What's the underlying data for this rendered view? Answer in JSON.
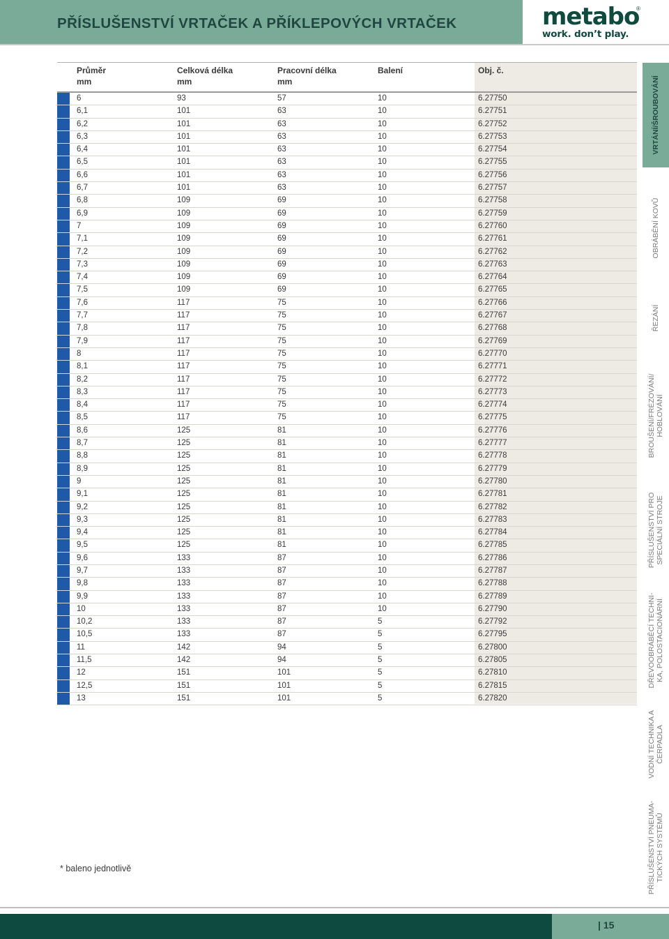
{
  "header": {
    "title": "PŘÍSLUŠENSTVÍ VRTAČEK A PŘÍKLEPOVÝCH VRTAČEK"
  },
  "brand": {
    "logo_text": "metabo",
    "registered": "®",
    "tagline": "work. don’t play.",
    "color": "#0f4a3e",
    "accent": "#7aab99",
    "row_marker_color": "#1f5aa8"
  },
  "table": {
    "columns": [
      {
        "label": "Průměr",
        "unit": "mm"
      },
      {
        "label": "Celková délka",
        "unit": "mm"
      },
      {
        "label": "Pracovní délka",
        "unit": "mm"
      },
      {
        "label": "Balení",
        "unit": ""
      },
      {
        "label": "Obj. č.",
        "unit": ""
      }
    ],
    "rows": [
      [
        "6",
        "93",
        "57",
        "10",
        "6.27750"
      ],
      [
        "6,1",
        "101",
        "63",
        "10",
        "6.27751"
      ],
      [
        "6,2",
        "101",
        "63",
        "10",
        "6.27752"
      ],
      [
        "6,3",
        "101",
        "63",
        "10",
        "6.27753"
      ],
      [
        "6,4",
        "101",
        "63",
        "10",
        "6.27754"
      ],
      [
        "6,5",
        "101",
        "63",
        "10",
        "6.27755"
      ],
      [
        "6,6",
        "101",
        "63",
        "10",
        "6.27756"
      ],
      [
        "6,7",
        "101",
        "63",
        "10",
        "6.27757"
      ],
      [
        "6,8",
        "109",
        "69",
        "10",
        "6.27758"
      ],
      [
        "6,9",
        "109",
        "69",
        "10",
        "6.27759"
      ],
      [
        "7",
        "109",
        "69",
        "10",
        "6.27760"
      ],
      [
        "7,1",
        "109",
        "69",
        "10",
        "6.27761"
      ],
      [
        "7,2",
        "109",
        "69",
        "10",
        "6.27762"
      ],
      [
        "7,3",
        "109",
        "69",
        "10",
        "6.27763"
      ],
      [
        "7,4",
        "109",
        "69",
        "10",
        "6.27764"
      ],
      [
        "7,5",
        "109",
        "69",
        "10",
        "6.27765"
      ],
      [
        "7,6",
        "117",
        "75",
        "10",
        "6.27766"
      ],
      [
        "7,7",
        "117",
        "75",
        "10",
        "6.27767"
      ],
      [
        "7,8",
        "117",
        "75",
        "10",
        "6.27768"
      ],
      [
        "7,9",
        "117",
        "75",
        "10",
        "6.27769"
      ],
      [
        "8",
        "117",
        "75",
        "10",
        "6.27770"
      ],
      [
        "8,1",
        "117",
        "75",
        "10",
        "6.27771"
      ],
      [
        "8,2",
        "117",
        "75",
        "10",
        "6.27772"
      ],
      [
        "8,3",
        "117",
        "75",
        "10",
        "6.27773"
      ],
      [
        "8,4",
        "117",
        "75",
        "10",
        "6.27774"
      ],
      [
        "8,5",
        "117",
        "75",
        "10",
        "6.27775"
      ],
      [
        "8,6",
        "125",
        "81",
        "10",
        "6.27776"
      ],
      [
        "8,7",
        "125",
        "81",
        "10",
        "6.27777"
      ],
      [
        "8,8",
        "125",
        "81",
        "10",
        "6.27778"
      ],
      [
        "8,9",
        "125",
        "81",
        "10",
        "6.27779"
      ],
      [
        "9",
        "125",
        "81",
        "10",
        "6.27780"
      ],
      [
        "9,1",
        "125",
        "81",
        "10",
        "6.27781"
      ],
      [
        "9,2",
        "125",
        "81",
        "10",
        "6.27782"
      ],
      [
        "9,3",
        "125",
        "81",
        "10",
        "6.27783"
      ],
      [
        "9,4",
        "125",
        "81",
        "10",
        "6.27784"
      ],
      [
        "9,5",
        "125",
        "81",
        "10",
        "6.27785"
      ],
      [
        "9,6",
        "133",
        "87",
        "10",
        "6.27786"
      ],
      [
        "9,7",
        "133",
        "87",
        "10",
        "6.27787"
      ],
      [
        "9,8",
        "133",
        "87",
        "10",
        "6.27788"
      ],
      [
        "9,9",
        "133",
        "87",
        "10",
        "6.27789"
      ],
      [
        "10",
        "133",
        "87",
        "10",
        "6.27790"
      ],
      [
        "10,2",
        "133",
        "87",
        "5",
        "6.27792"
      ],
      [
        "10,5",
        "133",
        "87",
        "5",
        "6.27795"
      ],
      [
        "11",
        "142",
        "94",
        "5",
        "6.27800"
      ],
      [
        "11,5",
        "142",
        "94",
        "5",
        "6.27805"
      ],
      [
        "12",
        "151",
        "101",
        "5",
        "6.27810"
      ],
      [
        "12,5",
        "151",
        "101",
        "5",
        "6.27815"
      ],
      [
        "13",
        "151",
        "101",
        "5",
        "6.27820"
      ]
    ]
  },
  "footnote": "* baleno jednotlivě",
  "sidenav": [
    {
      "lines": [
        "VRTÁNÍ/ŠROUBOVÁNÍ"
      ],
      "active": true
    },
    {
      "lines": [
        "OBRÁBĚNÍ KOVŮ"
      ],
      "active": false
    },
    {
      "lines": [
        "ŘEZÁNÍ"
      ],
      "active": false
    },
    {
      "lines": [
        "BROUŠENÍ/FRÉZOVÁNÍ/",
        "HOBLOVÁNÍ"
      ],
      "active": false
    },
    {
      "lines": [
        "PŘÍSLUŠENSTVÍ PRO",
        "SPECIÁLNÍ STROJE"
      ],
      "active": false
    },
    {
      "lines": [
        "DŘEVOOBRÁBĚCÍ TECHNI-",
        "KA, POLOSTACIONÁRNÍ"
      ],
      "active": false
    },
    {
      "lines": [
        "VODNÍ TECHNIKA A",
        "ČERPADLA"
      ],
      "active": false
    },
    {
      "lines": [
        "PŘÍSLUŠENSTVÍ PNEUMA-",
        "TICKÝCH SYSTÉMŮ"
      ],
      "active": false
    }
  ],
  "footer": {
    "page_number": "| 15"
  }
}
